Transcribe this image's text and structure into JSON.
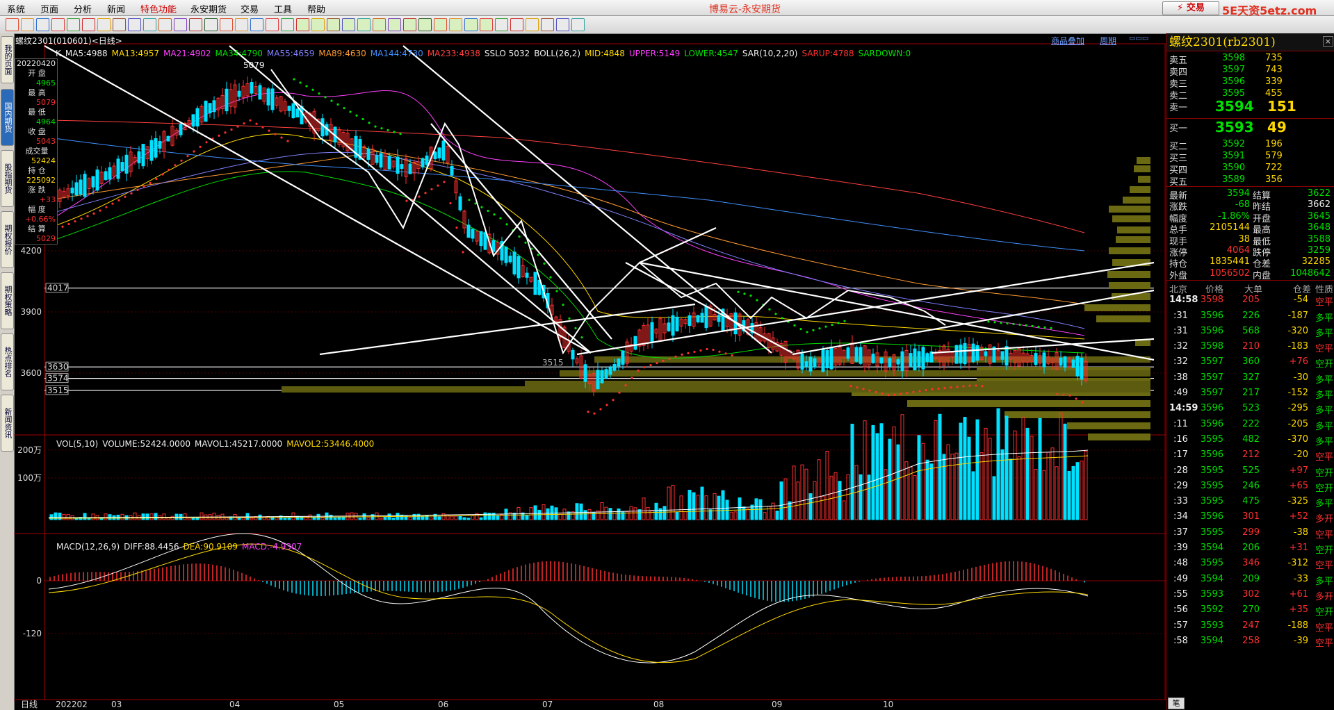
{
  "menu": [
    "系统",
    "页面",
    "分析",
    "新闻",
    "特色功能",
    "永安期货",
    "交易",
    "工具",
    "帮助"
  ],
  "app_title": "博易云-永安期货",
  "trade_button": "交易",
  "watermark": "5E天资5etz.com",
  "left_tabs": [
    "我的页面",
    "国内期货",
    "股指期货",
    "期权报价",
    "期权策略",
    "热点排名",
    "新闻资讯"
  ],
  "chart_header": {
    "symbol": "螺纹2301(010601)<日线>",
    "links": [
      "商品叠加",
      "周期"
    ]
  },
  "indicators": [
    {
      "text": "K",
      "color": "#eeeeee"
    },
    {
      "text": "MA5:4988",
      "color": "#eeeeee"
    },
    {
      "text": "MA13:4957",
      "color": "#ffd900"
    },
    {
      "text": "MA21:4902",
      "color": "#ff40ff"
    },
    {
      "text": "MA34:4790",
      "color": "#00e000"
    },
    {
      "text": "MA55:4659",
      "color": "#8080ff"
    },
    {
      "text": "MA89:4630",
      "color": "#ff9a30"
    },
    {
      "text": "MA144:4730",
      "color": "#4090ff"
    },
    {
      "text": "MA233:4938",
      "color": "#ff4040"
    },
    {
      "text": "SSLO 5032",
      "color": "#eeeeee"
    },
    {
      "text": "BOLL(26,2)",
      "color": "#eeeeee"
    },
    {
      "text": "MID:4848",
      "color": "#ffd900"
    },
    {
      "text": "UPPER:5149",
      "color": "#ff40ff"
    },
    {
      "text": "LOWER:4547",
      "color": "#00e000"
    },
    {
      "text": "SAR(10,2,20)",
      "color": "#eeeeee"
    },
    {
      "text": "SARUP:4788",
      "color": "#ff3030"
    },
    {
      "text": "SARDOWN:0",
      "color": "#00e000"
    }
  ],
  "info_box": [
    {
      "label": "20220420",
      "value": "",
      "color": "#eeeeee"
    },
    {
      "label": "开 盘",
      "value": "4965",
      "color": "#00e000"
    },
    {
      "label": "最 高",
      "value": "5079",
      "color": "#ff3030"
    },
    {
      "label": "最 低",
      "value": "4964",
      "color": "#00e000"
    },
    {
      "label": "收 盘",
      "value": "5043",
      "color": "#ff3030"
    },
    {
      "label": "成交量",
      "value": "52424",
      "color": "#ffd900"
    },
    {
      "label": "持 仓",
      "value": "225092",
      "color": "#ffd900"
    },
    {
      "label": "涨 跌",
      "value": "+33",
      "color": "#ff3030"
    },
    {
      "label": "幅 度",
      "value": "+0.66%",
      "color": "#ff3030"
    },
    {
      "label": "结 算",
      "value": "5029",
      "color": "#ff3030"
    }
  ],
  "price_axis": [
    "4200",
    "3900",
    "3600"
  ],
  "price_lines": [
    "4017",
    "3630",
    "3574",
    "3515"
  ],
  "peak_label": "5079",
  "low_label": "3515",
  "vol_header": [
    {
      "text": "VOL(5,10)",
      "color": "#eeeeee"
    },
    {
      "text": "VOLUME:52424.0000",
      "color": "#eeeeee"
    },
    {
      "text": "MAVOL1:45217.0000",
      "color": "#eeeeee"
    },
    {
      "text": "MAVOL2:53446.4000",
      "color": "#ffd900"
    }
  ],
  "vol_axis": [
    "200万",
    "100万"
  ],
  "macd_header": [
    {
      "text": "MACD(12,26,9)",
      "color": "#eeeeee"
    },
    {
      "text": "DIFF:88.4456",
      "color": "#eeeeee"
    },
    {
      "text": "DEA:90.9109",
      "color": "#ffd900"
    },
    {
      "text": "MACD:-4.9307",
      "color": "#ff40ff"
    }
  ],
  "macd_axis": [
    "0",
    "-120"
  ],
  "x_axis": [
    "日线",
    "202202",
    "03",
    "04",
    "05",
    "06",
    "07",
    "08",
    "09",
    "10"
  ],
  "quote": {
    "title": "螺纹2301(rb2301)",
    "asks": [
      {
        "label": "卖五",
        "price": "3598",
        "vol": "735"
      },
      {
        "label": "卖四",
        "price": "3597",
        "vol": "743"
      },
      {
        "label": "卖三",
        "price": "3596",
        "vol": "339"
      },
      {
        "label": "卖二",
        "price": "3595",
        "vol": "455"
      },
      {
        "label": "卖一",
        "price": "3594",
        "vol": "151"
      }
    ],
    "bids": [
      {
        "label": "买一",
        "price": "3593",
        "vol": "49"
      },
      {
        "label": "买二",
        "price": "3592",
        "vol": "196"
      },
      {
        "label": "买三",
        "price": "3591",
        "vol": "579"
      },
      {
        "label": "买四",
        "price": "3590",
        "vol": "722"
      },
      {
        "label": "买五",
        "price": "3589",
        "vol": "356"
      }
    ],
    "stats": [
      {
        "l1": "最新",
        "v1": "3594",
        "c1": "#00e000",
        "l2": "结算",
        "v2": "3622",
        "c2": "#00e000"
      },
      {
        "l1": "涨跌",
        "v1": "-68",
        "c1": "#00e000",
        "l2": "昨结",
        "v2": "3662",
        "c2": "#eeeeee"
      },
      {
        "l1": "幅度",
        "v1": "-1.86%",
        "c1": "#00e000",
        "l2": "开盘",
        "v2": "3645",
        "c2": "#00e000"
      },
      {
        "l1": "总手",
        "v1": "2105144",
        "c1": "#ffd900",
        "l2": "最高",
        "v2": "3648",
        "c2": "#00e000"
      },
      {
        "l1": "现手",
        "v1": "38",
        "c1": "#ffd900",
        "l2": "最低",
        "v2": "3588",
        "c2": "#00e000"
      },
      {
        "l1": "涨停",
        "v1": "4064",
        "c1": "#ff3030",
        "l2": "跌停",
        "v2": "3259",
        "c2": "#00e000"
      },
      {
        "l1": "持仓",
        "v1": "1835441",
        "c1": "#ffd900",
        "l2": "仓差",
        "v2": "32285",
        "c2": "#ffd900"
      },
      {
        "l1": "外盘",
        "v1": "1056502",
        "c1": "#ff3030",
        "l2": "内盘",
        "v2": "1048642",
        "c2": "#00e000"
      }
    ],
    "tick_header": [
      "北京",
      "价格",
      "大单",
      "仓差",
      "性质"
    ],
    "ticks": [
      {
        "time": "14:58",
        "price": "3598",
        "vol": "205",
        "diff": "-54",
        "nature": "空平",
        "pc": "#ff3030",
        "vc": "#ff3030",
        "nc": "#ff3030"
      },
      {
        "time": ":31",
        "price": "3596",
        "vol": "226",
        "diff": "-187",
        "nature": "多平",
        "pc": "#00e000",
        "vc": "#00e000",
        "nc": "#00e000"
      },
      {
        "time": ":31",
        "price": "3596",
        "vol": "568",
        "diff": "-320",
        "nature": "多平",
        "pc": "#00e000",
        "vc": "#00e000",
        "nc": "#00e000"
      },
      {
        "time": ":32",
        "price": "3598",
        "vol": "210",
        "diff": "-183",
        "nature": "空平",
        "pc": "#00e000",
        "vc": "#ff3030",
        "nc": "#ff3030"
      },
      {
        "time": ":32",
        "price": "3597",
        "vol": "360",
        "diff": "+76",
        "nature": "空开",
        "pc": "#00e000",
        "vc": "#00e000",
        "nc": "#00e000"
      },
      {
        "time": ":38",
        "price": "3597",
        "vol": "327",
        "diff": "-30",
        "nature": "多平",
        "pc": "#00e000",
        "vc": "#00e000",
        "nc": "#00e000"
      },
      {
        "time": ":49",
        "price": "3597",
        "vol": "217",
        "diff": "-152",
        "nature": "多平",
        "pc": "#00e000",
        "vc": "#00e000",
        "nc": "#00e000"
      },
      {
        "time": "14:59",
        "price": "3596",
        "vol": "523",
        "diff": "-295",
        "nature": "多平",
        "pc": "#00e000",
        "vc": "#00e000",
        "nc": "#00e000"
      },
      {
        "time": ":11",
        "price": "3596",
        "vol": "222",
        "diff": "-205",
        "nature": "多平",
        "pc": "#00e000",
        "vc": "#00e000",
        "nc": "#00e000"
      },
      {
        "time": ":16",
        "price": "3595",
        "vol": "482",
        "diff": "-370",
        "nature": "多平",
        "pc": "#00e000",
        "vc": "#00e000",
        "nc": "#00e000"
      },
      {
        "time": ":17",
        "price": "3596",
        "vol": "212",
        "diff": "-20",
        "nature": "空平",
        "pc": "#00e000",
        "vc": "#ff3030",
        "nc": "#ff3030"
      },
      {
        "time": ":28",
        "price": "3595",
        "vol": "525",
        "diff": "+97",
        "nature": "空开",
        "pc": "#00e000",
        "vc": "#00e000",
        "nc": "#00e000"
      },
      {
        "time": ":29",
        "price": "3595",
        "vol": "246",
        "diff": "+65",
        "nature": "空开",
        "pc": "#00e000",
        "vc": "#00e000",
        "nc": "#00e000"
      },
      {
        "time": ":33",
        "price": "3595",
        "vol": "475",
        "diff": "-325",
        "nature": "多平",
        "pc": "#00e000",
        "vc": "#00e000",
        "nc": "#00e000"
      },
      {
        "time": ":34",
        "price": "3596",
        "vol": "301",
        "diff": "+52",
        "nature": "多开",
        "pc": "#00e000",
        "vc": "#ff3030",
        "nc": "#ff3030"
      },
      {
        "time": ":37",
        "price": "3595",
        "vol": "299",
        "diff": "-38",
        "nature": "空平",
        "pc": "#00e000",
        "vc": "#ff3030",
        "nc": "#ff3030"
      },
      {
        "time": ":39",
        "price": "3594",
        "vol": "206",
        "diff": "+31",
        "nature": "空开",
        "pc": "#00e000",
        "vc": "#00e000",
        "nc": "#00e000"
      },
      {
        "time": ":48",
        "price": "3595",
        "vol": "346",
        "diff": "-312",
        "nature": "空平",
        "pc": "#00e000",
        "vc": "#ff3030",
        "nc": "#ff3030"
      },
      {
        "time": ":49",
        "price": "3594",
        "vol": "209",
        "diff": "-33",
        "nature": "多平",
        "pc": "#00e000",
        "vc": "#00e000",
        "nc": "#00e000"
      },
      {
        "time": ":55",
        "price": "3593",
        "vol": "302",
        "diff": "+61",
        "nature": "多开",
        "pc": "#00e000",
        "vc": "#ff3030",
        "nc": "#ff3030"
      },
      {
        "time": ":56",
        "price": "3592",
        "vol": "270",
        "diff": "+35",
        "nature": "空开",
        "pc": "#00e000",
        "vc": "#00e000",
        "nc": "#00e000"
      },
      {
        "time": ":57",
        "price": "3593",
        "vol": "247",
        "diff": "-188",
        "nature": "空平",
        "pc": "#00e000",
        "vc": "#ff3030",
        "nc": "#ff3030"
      },
      {
        "time": ":58",
        "price": "3594",
        "vol": "258",
        "diff": "-39",
        "nature": "空平",
        "pc": "#00e000",
        "vc": "#ff3030",
        "nc": "#ff3030"
      }
    ],
    "bottom_tab": "笔"
  }
}
